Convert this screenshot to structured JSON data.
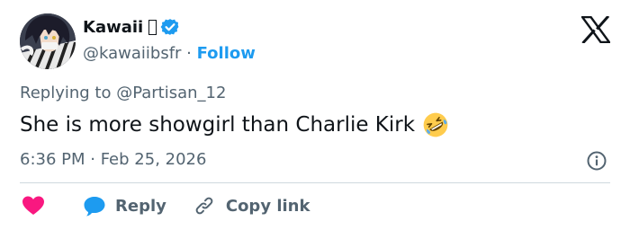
{
  "author": {
    "display_name": "Kawaii",
    "handle": "@kawaiibsfr",
    "separator": " · ",
    "follow_label": "Follow",
    "verified_color": "#1d9bf0"
  },
  "reply_context": {
    "prefix": "Replying to ",
    "mention": "@Partisan_12"
  },
  "tweet": {
    "text": "She is more showgirl than Charlie Kirk",
    "emoji_icon": "rolling-on-floor-laughing-emoji"
  },
  "timestamp": "6:36 PM · Feb 25, 2026",
  "actions": {
    "reply_label": "Reply",
    "copy_link_label": "Copy link"
  },
  "colors": {
    "accent": "#1d9bf0",
    "like": "#f91880",
    "text": "#0f1419",
    "secondary": "#536471",
    "divider": "#cfd9de"
  }
}
